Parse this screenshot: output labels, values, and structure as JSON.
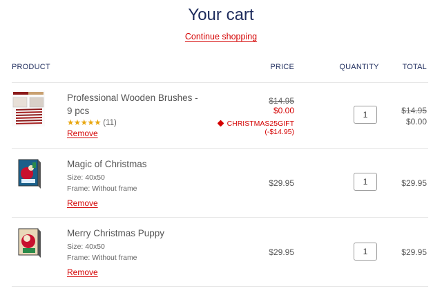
{
  "header": {
    "title": "Your cart",
    "continue_label": "Continue shopping"
  },
  "columns": {
    "product": "PRODUCT",
    "price": "PRICE",
    "quantity": "QUANTITY",
    "total": "TOTAL"
  },
  "items": [
    {
      "name": "Professional Wooden Brushes - 9 pcs",
      "rating_stars": "★★★★★",
      "rating_count": "(11)",
      "original_price": "$14.95",
      "final_price": "$0.00",
      "discount_code": "CHRISTMAS25GIFT",
      "discount_amount": "(-$14.95)",
      "quantity": "1",
      "total_original": "$14.95",
      "total_final": "$0.00",
      "remove_label": "Remove"
    },
    {
      "name": "Magic of Christmas",
      "size": "Size: 40x50",
      "frame": "Frame: Without frame",
      "price": "$29.95",
      "quantity": "1",
      "total": "$29.95",
      "remove_label": "Remove"
    },
    {
      "name": "Merry Christmas Puppy",
      "size": "Size: 40x50",
      "frame": "Frame: Without frame",
      "price": "$29.95",
      "quantity": "1",
      "total": "$29.95",
      "remove_label": "Remove"
    }
  ],
  "colors": {
    "title": "#1d2b5c",
    "accent": "#d40000",
    "star": "#e8a60e",
    "divider": "#e6e6e6"
  }
}
